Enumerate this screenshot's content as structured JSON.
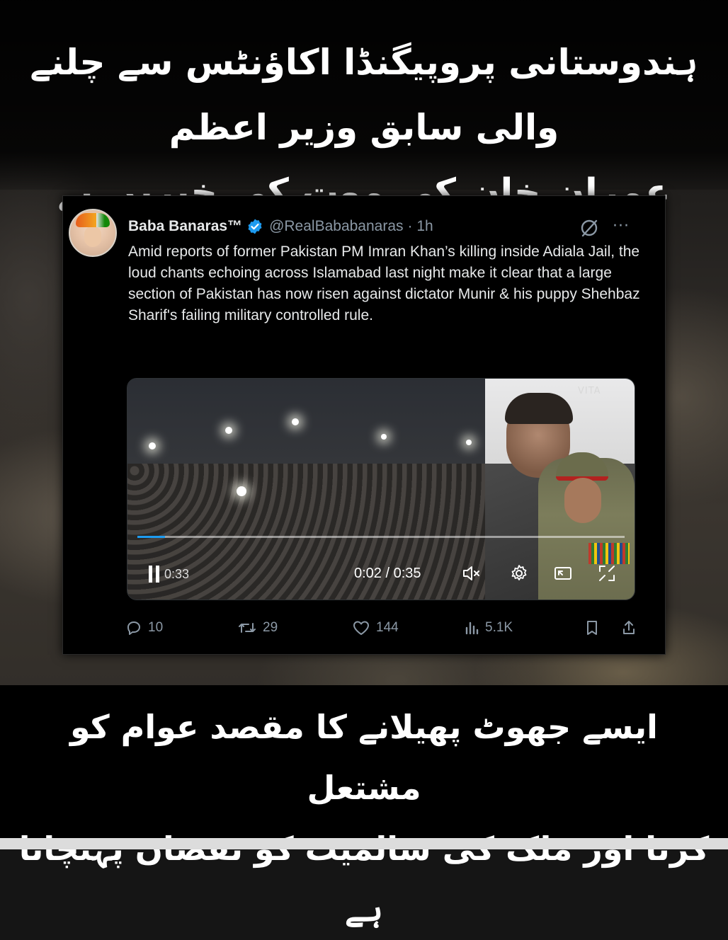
{
  "headline": {
    "line1": "ہندوستانی پروپیگنڈا اکاؤنٹس سے چلنے والی سابق وزیر اعظم",
    "line2": "عمران خان کی موت کی خبریں بے بنیاد اور من گھڑت ہیں"
  },
  "tweet": {
    "display_name": "Baba Banaras™",
    "handle": "@RealBababanaras",
    "time": "· 1h",
    "text": "Amid reports of former Pakistan PM Imran Khan’s killing inside Adiala Jail, the loud chants echoing across Islamabad last night make it clear that a large section of Pakistan has now risen against dictator Munir & his puppy Shehbaz Sharif's failing military controlled rule.",
    "more": "···",
    "video": {
      "watermark": "VITA",
      "elapsed": "0:33",
      "timecode": "0:02 / 0:35",
      "progress": 0.057
    },
    "actions": {
      "replies": "10",
      "reposts": "29",
      "likes": "144",
      "views": "5.1K"
    }
  },
  "bottom_banner": {
    "line1": "ایسے جھوٹ پھیلانے کا مقصد عوام کو مشتعل",
    "line2": "کرنا اور ملک کی سالمیت کو نقصان پہنچانا ہے"
  },
  "colors": {
    "verified": "#1d9bf0",
    "muted_text": "#8b98a5",
    "text": "#e7e9ea"
  },
  "icons": [
    "verified-badge-icon",
    "grok-icon",
    "more-icon",
    "pause-icon",
    "mute-icon",
    "settings-icon",
    "pip-icon",
    "fullscreen-icon",
    "reply-icon",
    "repost-icon",
    "like-icon",
    "views-icon",
    "bookmark-icon",
    "share-icon"
  ]
}
